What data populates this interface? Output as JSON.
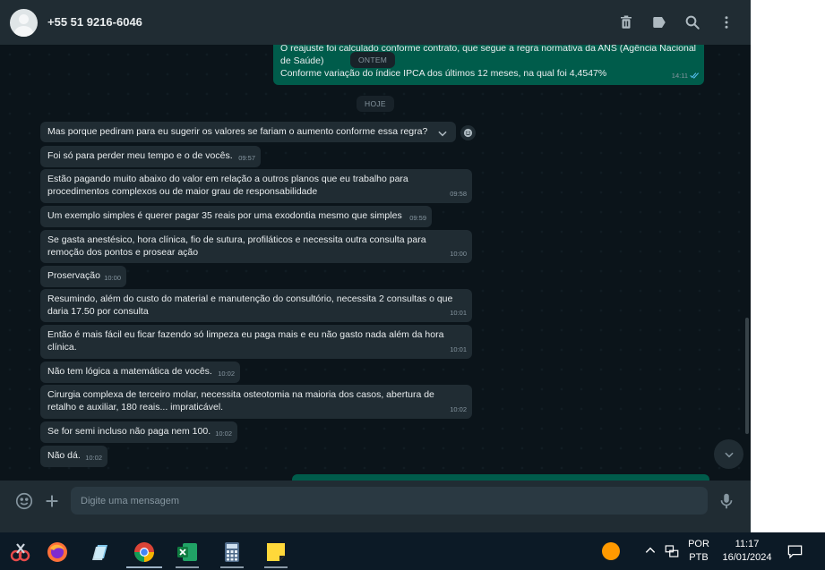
{
  "header": {
    "contact_name": "+55 51 9216-6046",
    "icons": [
      "delete-icon",
      "label-icon",
      "search-icon",
      "menu-icon"
    ]
  },
  "chat": {
    "previous_out_message": {
      "line1": "O reajuste foi calculado conforme contrato, que segue a regra normativa da ANS (Agência Nacional",
      "line2": "de Saúde)",
      "line3": "Conforme variação do índice IPCA dos últimos 12 meses, na qual foi 4,4547%",
      "time": "14:11"
    },
    "date_chip_yesterday": "ONTEM",
    "date_chip_today": "HOJE",
    "messages": [
      {
        "text": "Mas porque pediram para eu sugerir os valores se fariam o aumento conforme essa regra?",
        "time": ""
      },
      {
        "text": "Foi só para perder meu tempo e o de vocês.",
        "time": "09:57"
      },
      {
        "text": "Estão pagando muito abaixo do valor em relação a outros planos que eu trabalho para procedimentos complexos ou de maior grau de responsabilidade",
        "time": "09:58"
      },
      {
        "text": "Um exemplo simples é querer pagar 35 reais por uma exodontia mesmo que simples",
        "time": "09:59"
      },
      {
        "text": "Se gasta anestésico, hora clínica, fio de sutura, profiláticos e necessita outra consulta para remoção dos pontos e prosear ação",
        "time": "10:00"
      },
      {
        "text": "Proservação",
        "time": "10:00"
      },
      {
        "text": "Resumindo, além do custo do material e manutenção do consultório, necessita 2 consultas o que daria 17.50 por consulta",
        "time": "10:01"
      },
      {
        "text": "Então é mais fácil eu ficar fazendo só limpeza eu paga mais e eu não gasto nada além da hora clínica.",
        "time": "10:01"
      },
      {
        "text": "Não tem lógica a matemática de vocês.",
        "time": "10:02"
      },
      {
        "text": "Cirurgia complexa de terceiro molar, necessita osteotomia na maioria dos casos, abertura de retalho e auxiliar, 180 reais... impraticável.",
        "time": "10:02"
      },
      {
        "text": "Se for semi incluso não paga nem 100.",
        "time": "10:02"
      },
      {
        "text": "Não dá.",
        "time": "10:02"
      }
    ]
  },
  "composer": {
    "placeholder": "Digite uma mensagem",
    "value": ""
  },
  "taskbar": {
    "apps": [
      "snipping-tool",
      "firefox",
      "notepad",
      "chrome",
      "excel",
      "calculator",
      "sticky-notes"
    ],
    "active_app": "chrome",
    "language_line1": "POR",
    "language_line2": "PTB",
    "clock_time": "11:17",
    "clock_date": "16/01/2024"
  },
  "colors": {
    "chat_bg": "#0b141a",
    "panel_bg": "#202c33",
    "incoming_bubble": "#202c33",
    "outgoing_bubble": "#005c4b",
    "text_primary": "#e9edef",
    "text_secondary": "#8696a0",
    "read_tick": "#53bdeb"
  }
}
